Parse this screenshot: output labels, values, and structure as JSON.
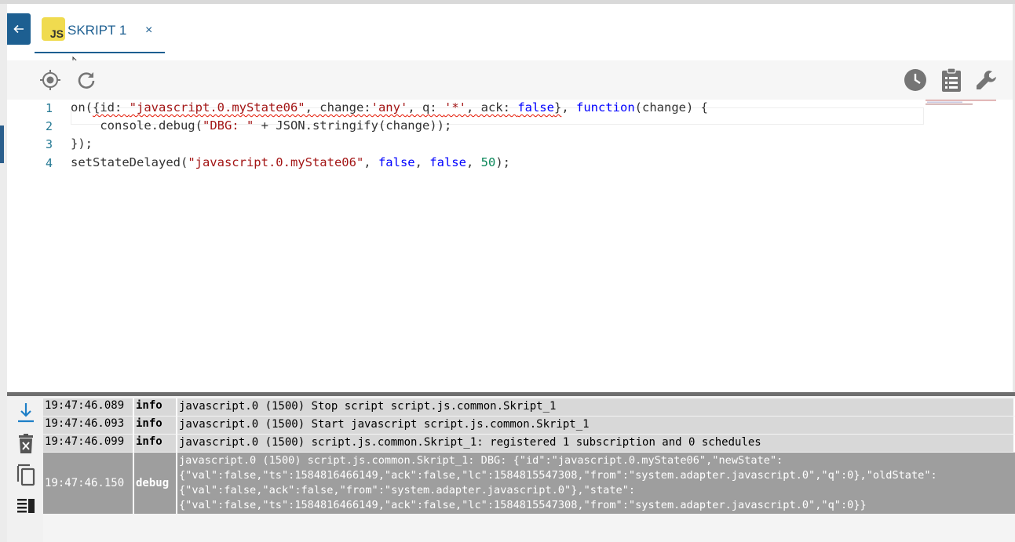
{
  "tab": {
    "icon_label": "JS",
    "title": "SKRIPT 1",
    "close": "×"
  },
  "colors": {
    "accent": "#1d5f91",
    "js_yellow": "#f0db4f",
    "string": "#a31515",
    "keyword": "#0000ff",
    "number": "#098658"
  },
  "toolbar": {
    "left_icons": [
      "crosshair-icon",
      "refresh-icon"
    ],
    "right_icons": [
      "clock-icon",
      "clipboard-icon",
      "wrench-icon"
    ]
  },
  "editor": {
    "line_numbers": [
      "1",
      "2",
      "3",
      "4"
    ],
    "l1": {
      "a": "on(",
      "b": "{id: ",
      "c": "\"javascript.0.myState06\"",
      "d": ", change:",
      "e": "'any'",
      "f": ", q: ",
      "g": "'*'",
      "h": ", ack: ",
      "i": "false",
      "j": "}",
      "k": ", ",
      "l": "function",
      "m": "(change) {"
    },
    "l2": {
      "indent": "    ",
      "a": "console.debug(",
      "b": "\"DBG: \"",
      "c": " + JSON.stringify(change));"
    },
    "l3": {
      "a": "});"
    },
    "l4": {
      "a": "setStateDelayed(",
      "b": "\"javascript.0.myState06\"",
      "c": ", ",
      "d": "false",
      "e": ", ",
      "f": "false",
      "g": ", ",
      "h": "50",
      "i": ");"
    }
  },
  "log": {
    "side_icons": [
      "scroll-down-icon",
      "delete-log-icon",
      "copy-icon",
      "toggle-view-icon"
    ],
    "rows": [
      {
        "time": "19:47:46.089",
        "level": "info",
        "message": "javascript.0 (1500) Stop script script.js.common.Skript_1"
      },
      {
        "time": "19:47:46.093",
        "level": "info",
        "message": "javascript.0 (1500) Start javascript script.js.common.Skript_1"
      },
      {
        "time": "19:47:46.099",
        "level": "info",
        "message": "javascript.0 (1500) script.js.common.Skript_1: registered 1 subscription and 0 schedules"
      },
      {
        "time": "19:47:46.150",
        "level": "debug",
        "message": "javascript.0 (1500) script.js.common.Skript_1: DBG: {\"id\":\"javascript.0.myState06\",\"newState\":\n{\"val\":false,\"ts\":1584816466149,\"ack\":false,\"lc\":1584815547308,\"from\":\"system.adapter.javascript.0\",\"q\":0},\"oldState\":\n{\"val\":false,\"ack\":false,\"from\":\"system.adapter.javascript.0\"},\"state\":\n{\"val\":false,\"ts\":1584816466149,\"ack\":false,\"lc\":1584815547308,\"from\":\"system.adapter.javascript.0\",\"q\":0}}"
      }
    ]
  }
}
